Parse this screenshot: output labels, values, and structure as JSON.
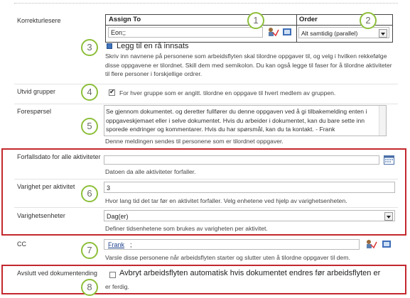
{
  "rows": {
    "korrekturlesere": {
      "label": "Korrekturlesere",
      "assign_header": "Assign To",
      "order_header": "Order",
      "assign_value": "Eon;;",
      "order_value": "Alt samtidig (parallel)",
      "add_stage": "Legg til en rå innsats",
      "description": "Skriv inn navnene på personene som arbeidsflyten skal tilordne oppgaver til, og velg i hvilken rekkefølge disse oppgavene er tilordnet. Skill dem med semikolon. Du kan også legge til faser for å tilordne aktiviteter til flere personer i forskjellige ordrer."
    },
    "utvid_grupper": {
      "label": "Utvid grupper",
      "checkbox_label": "For hver gruppe som er angitt. tilordne en oppgave til hvert medlem av gruppen.",
      "checked": true
    },
    "foresporsel": {
      "label": "Forespørsel",
      "text": "Se gjennom dokumentet. og deretter fullfører du denne oppgaven ved å gi tilbakemelding enten i oppgaveskjemaet eller i selve dokumentet. Hvis du arbeider i dokumentet, kan du bare sette inn sporede endringer og kommentarer. Hvis du har spørsmål, kan du ta kontakt. - Frank",
      "note": "Denne meldingen sendes til personene som er tilordnet oppgaver."
    },
    "forfallsdato": {
      "label": "Forfallsdato for alle aktiviteter",
      "description": "Datoen da alle aktiviteter forfaller."
    },
    "varighet": {
      "label": "Varighet per aktivitet",
      "value": "3",
      "description": "Hvor lang tid det tar før en aktivitet forfaller. Velg enhetene ved hjelp av varighetsenheten."
    },
    "varighetsenheter": {
      "label": "Varighetsenheter",
      "value": "Dag(er)",
      "description": "Definer tidsenhetene som brukes av varigheten per aktivitet."
    },
    "cc": {
      "label": "CC",
      "value": "Frank",
      "separator": ";",
      "description": "Varsle disse personene når arbeidsflyten starter og slutter uten å tilordne oppgaver til dem."
    },
    "avslutt": {
      "label": "Avslutt ved dokumentending",
      "checkbox_label": "Avbryt arbeidsflyten automatisk hvis dokumentet endres før arbeidsflyten er",
      "checkbox_label2": "er ferdig.",
      "checked": false
    }
  },
  "callouts": [
    "1",
    "2",
    "3",
    "4",
    "5",
    "6",
    "7",
    "8"
  ],
  "colors": {
    "callout_ring": "#8dbf3a",
    "highlight": "#c3282d",
    "link": "#1b3f8b"
  }
}
